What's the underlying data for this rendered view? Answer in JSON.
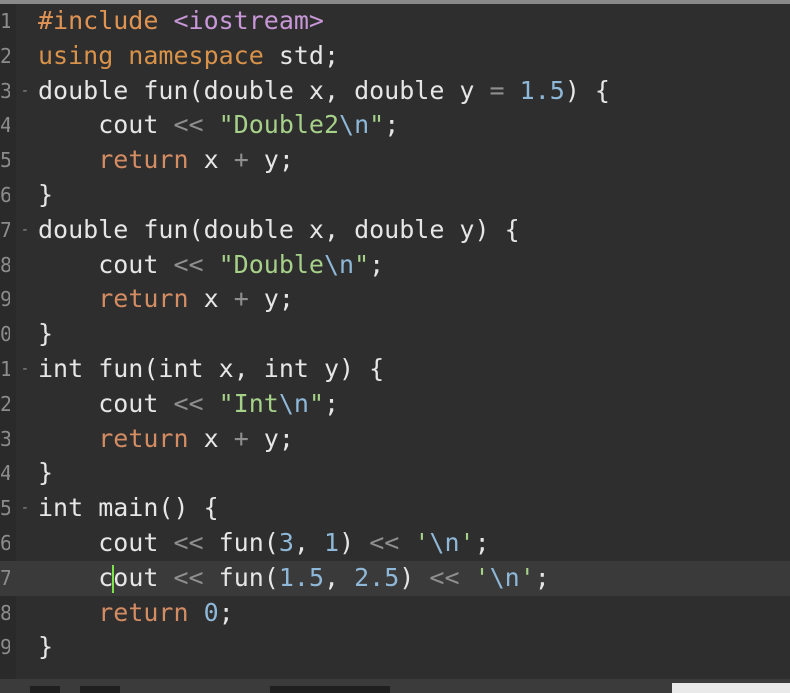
{
  "editor": {
    "lines": [
      {
        "num": "1",
        "fold": "",
        "tokens": [
          {
            "t": "#include ",
            "c": "tk-pre"
          },
          {
            "t": "<iostream>",
            "c": "tk-inc"
          }
        ]
      },
      {
        "num": "2",
        "fold": "",
        "tokens": [
          {
            "t": "using namespace ",
            "c": "tk-ns"
          },
          {
            "t": "std;",
            "c": "tk-id"
          }
        ]
      },
      {
        "num": "3",
        "fold": "-",
        "tokens": [
          {
            "t": "double fun(double x, double y ",
            "c": "tk-id"
          },
          {
            "t": "= ",
            "c": "tk-op"
          },
          {
            "t": "1.5",
            "c": "tk-num"
          },
          {
            "t": ") {",
            "c": "tk-id"
          }
        ]
      },
      {
        "num": "4",
        "fold": "",
        "tokens": [
          {
            "t": "    cout ",
            "c": "tk-id"
          },
          {
            "t": "<< ",
            "c": "tk-op"
          },
          {
            "t": "\"Double2",
            "c": "tk-str"
          },
          {
            "t": "\\n",
            "c": "tk-esc"
          },
          {
            "t": "\"",
            "c": "tk-str"
          },
          {
            "t": ";",
            "c": "tk-id"
          }
        ]
      },
      {
        "num": "5",
        "fold": "",
        "tokens": [
          {
            "t": "    ",
            "c": "tk-id"
          },
          {
            "t": "return ",
            "c": "tk-ret"
          },
          {
            "t": "x ",
            "c": "tk-id"
          },
          {
            "t": "+ ",
            "c": "tk-op"
          },
          {
            "t": "y;",
            "c": "tk-id"
          }
        ]
      },
      {
        "num": "6",
        "fold": "",
        "tokens": [
          {
            "t": "}",
            "c": "tk-id"
          }
        ]
      },
      {
        "num": "7",
        "fold": "-",
        "tokens": [
          {
            "t": "double fun(double x, double y) {",
            "c": "tk-id"
          }
        ]
      },
      {
        "num": "8",
        "fold": "",
        "tokens": [
          {
            "t": "    cout ",
            "c": "tk-id"
          },
          {
            "t": "<< ",
            "c": "tk-op"
          },
          {
            "t": "\"Double",
            "c": "tk-str"
          },
          {
            "t": "\\n",
            "c": "tk-esc"
          },
          {
            "t": "\"",
            "c": "tk-str"
          },
          {
            "t": ";",
            "c": "tk-id"
          }
        ]
      },
      {
        "num": "9",
        "fold": "",
        "tokens": [
          {
            "t": "    ",
            "c": "tk-id"
          },
          {
            "t": "return ",
            "c": "tk-ret"
          },
          {
            "t": "x ",
            "c": "tk-id"
          },
          {
            "t": "+ ",
            "c": "tk-op"
          },
          {
            "t": "y;",
            "c": "tk-id"
          }
        ]
      },
      {
        "num": "0",
        "fold": "",
        "tokens": [
          {
            "t": "}",
            "c": "tk-id"
          }
        ]
      },
      {
        "num": "1",
        "fold": "-",
        "tokens": [
          {
            "t": "int fun(int x, int y) {",
            "c": "tk-id"
          }
        ]
      },
      {
        "num": "2",
        "fold": "",
        "tokens": [
          {
            "t": "    cout ",
            "c": "tk-id"
          },
          {
            "t": "<< ",
            "c": "tk-op"
          },
          {
            "t": "\"Int",
            "c": "tk-str"
          },
          {
            "t": "\\n",
            "c": "tk-esc"
          },
          {
            "t": "\"",
            "c": "tk-str"
          },
          {
            "t": ";",
            "c": "tk-id"
          }
        ]
      },
      {
        "num": "3",
        "fold": "",
        "tokens": [
          {
            "t": "    ",
            "c": "tk-id"
          },
          {
            "t": "return ",
            "c": "tk-ret"
          },
          {
            "t": "x ",
            "c": "tk-id"
          },
          {
            "t": "+ ",
            "c": "tk-op"
          },
          {
            "t": "y;",
            "c": "tk-id"
          }
        ]
      },
      {
        "num": "4",
        "fold": "",
        "tokens": [
          {
            "t": "}",
            "c": "tk-id"
          }
        ]
      },
      {
        "num": "5",
        "fold": "-",
        "tokens": [
          {
            "t": "int main() {",
            "c": "tk-id"
          }
        ]
      },
      {
        "num": "6",
        "fold": "",
        "tokens": [
          {
            "t": "    cout ",
            "c": "tk-id"
          },
          {
            "t": "<< ",
            "c": "tk-op"
          },
          {
            "t": "fun(",
            "c": "tk-id"
          },
          {
            "t": "3",
            "c": "tk-num"
          },
          {
            "t": ", ",
            "c": "tk-id"
          },
          {
            "t": "1",
            "c": "tk-num"
          },
          {
            "t": ") ",
            "c": "tk-id"
          },
          {
            "t": "<< ",
            "c": "tk-op"
          },
          {
            "t": "'",
            "c": "tk-str"
          },
          {
            "t": "\\n",
            "c": "tk-esc"
          },
          {
            "t": "'",
            "c": "tk-str"
          },
          {
            "t": ";",
            "c": "tk-id"
          }
        ]
      },
      {
        "num": "7",
        "fold": "",
        "active": true,
        "cursor_after": 5,
        "tokens": [
          {
            "t": "    c",
            "c": "tk-id"
          },
          {
            "t": "out ",
            "c": "tk-id"
          },
          {
            "t": "<< ",
            "c": "tk-op"
          },
          {
            "t": "fun(",
            "c": "tk-id"
          },
          {
            "t": "1.5",
            "c": "tk-num"
          },
          {
            "t": ", ",
            "c": "tk-id"
          },
          {
            "t": "2.5",
            "c": "tk-num"
          },
          {
            "t": ") ",
            "c": "tk-id"
          },
          {
            "t": "<< ",
            "c": "tk-op"
          },
          {
            "t": "'",
            "c": "tk-str"
          },
          {
            "t": "\\n",
            "c": "tk-esc"
          },
          {
            "t": "'",
            "c": "tk-str"
          },
          {
            "t": ";",
            "c": "tk-id"
          }
        ]
      },
      {
        "num": "8",
        "fold": "",
        "tokens": [
          {
            "t": "    ",
            "c": "tk-id"
          },
          {
            "t": "return ",
            "c": "tk-ret"
          },
          {
            "t": "0",
            "c": "tk-num"
          },
          {
            "t": ";",
            "c": "tk-id"
          }
        ]
      },
      {
        "num": "9",
        "fold": "",
        "tokens": [
          {
            "t": "}",
            "c": "tk-id"
          }
        ]
      }
    ]
  },
  "colors": {
    "background": "#2e2e2e",
    "active_line": "#3a3a3a",
    "cursor": "#7ee04a",
    "string": "#a6d189",
    "number": "#8fb8d8",
    "keyword_return": "#d48c63",
    "preprocessor": "#e09454"
  }
}
